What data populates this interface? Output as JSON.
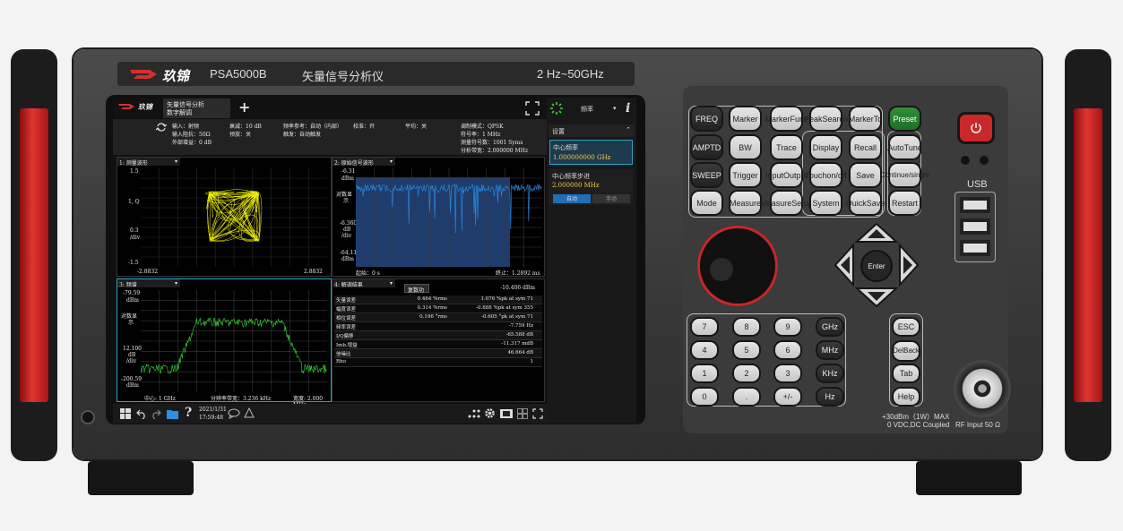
{
  "brand": {
    "logo_text": "玖锦",
    "model": "PSA5000B",
    "product_name": "矢量信号分析仪",
    "freq_range": "2 Hz~50GHz"
  },
  "screen": {
    "header": {
      "app_title": "矢量信号分析",
      "app_subtitle": "数字解调",
      "add_label": "+",
      "input_line": "输入：射频",
      "input_imp": "输入阻抗：50Ω",
      "ext_gain": "外部增益：0 dB",
      "atten": "衰减：10 dB",
      "preamp": "预放：关",
      "freq_ref": "频率参考：自动（内部）",
      "trigger": "触发：自动触发",
      "calib": "校准：开",
      "avg": "平均：关",
      "mod_fmt": "调制模式：QPSK",
      "sym_rate": "符号率：1 MHz",
      "meas_syms": "测量符号数：1001 Syms",
      "ana_bw": "分析带宽：2.000000 MHz"
    },
    "win1": {
      "title": "1: 测量波形",
      "y_top": "1.5",
      "y_mid": "1, Q",
      "y_div1": "0.3",
      "y_div2": "/div",
      "y_bot": "-1.5",
      "x_left": "-2.8832",
      "x_right": "2.8832"
    },
    "win2": {
      "title": "2: 原始信号波形",
      "y_top": "-6.31",
      "y_unit": "dBm",
      "y_lbl1": "对数显",
      "y_lbl2": "示",
      "y_m1": "-6.360",
      "y_m2": "dB",
      "y_m3": "/div",
      "y_bot": "-64.11",
      "y_bot_unit": "dBm",
      "x_start": "起始：0 s",
      "x_stop": "终止：1.2892 ms"
    },
    "win3": {
      "title": "3: 频谱",
      "y_top": "-79.59",
      "y_unit": "dBm",
      "y_lbl1": "对数显",
      "y_lbl2": "示",
      "y_m1": "12.100",
      "y_m2": "dB",
      "y_m3": "/div",
      "y_bot": "-200.59",
      "y_bot_unit": "dBm",
      "center": "中心: 1 GHz",
      "rbw": "分辨率带宽：3.236 kHz",
      "span": "宽度: 2.000 MHz"
    },
    "win4": {
      "title": "4: 解调结果",
      "tab": "复数功率",
      "power": "-10.406 dBm",
      "rows": [
        {
          "name": "矢量误差",
          "v1": "0.464 %rms",
          "v2": "1.076 %pk at sym 71"
        },
        {
          "name": "幅度误差",
          "v1": "0.314 %rms",
          "v2": "-0.888 %pk at sym 355"
        },
        {
          "name": "相位误差",
          "v1": "0.196 °rms",
          "v2": "-0.605 °pk at sym 71"
        },
        {
          "name": "频率误差",
          "v1": "",
          "v2": "-7.759 Hz"
        },
        {
          "name": "I/Q偏移",
          "v1": "",
          "v2": "-65.588 dB"
        },
        {
          "name": "Imb.增益",
          "v1": "",
          "v2": "-11.317 mdB"
        },
        {
          "name": "信噪比",
          "v1": "",
          "v2": "46.664 dB"
        },
        {
          "name": "Rho",
          "v1": "",
          "v2": "1"
        }
      ]
    },
    "taskbar": {
      "date": "2021/1/31",
      "time": "17:59:48"
    }
  },
  "panel": {
    "dropdown": "频率",
    "info": "i",
    "section": "设置",
    "center_label": "中心频率",
    "center_value": "1.000000000 GHz",
    "step_label": "中心频率步进",
    "step_value": "2.000000 MHz",
    "auto": "自动",
    "manual": "手动"
  },
  "keys": {
    "freq": "FREQ",
    "marker": "Marker",
    "marker_func": [
      "Marker",
      "Func"
    ],
    "peak_search": [
      "Peak",
      "Search"
    ],
    "marker_to": [
      "Marker",
      "To"
    ],
    "preset": "Preset",
    "amptd": "AMPTD",
    "bw": "BW",
    "trace": "Trace",
    "display": "Display",
    "recall": "Recall",
    "auto_tune": [
      "Auto",
      "Tune"
    ],
    "sweep": "SWEEP",
    "trigger": "Trigger",
    "input_output": [
      "Input",
      "Output"
    ],
    "touch": [
      "Touch",
      "on/off"
    ],
    "save": "Save",
    "continue": [
      "Continue",
      "/single"
    ],
    "mode": "Mode",
    "measure": "Measure",
    "measure_setup": [
      "Measure",
      "Setup"
    ],
    "system": "System",
    "quick_save": [
      "Quick",
      "Save"
    ],
    "restart": "Restart",
    "enter": "Enter",
    "k7": "7",
    "k8": "8",
    "k9": "9",
    "ghz": "GHz",
    "k4": "4",
    "k5": "5",
    "k6": "6",
    "mhz": "MHz",
    "k1": "1",
    "k2": "2",
    "k3": "3",
    "khz": "KHz",
    "k0": "0",
    "dot": ".",
    "pm": "+/-",
    "hz": "Hz",
    "esc": "ESC",
    "del": [
      "Del",
      "Back"
    ],
    "tab": "Tab",
    "help": "Help"
  },
  "usb_label": "USB",
  "rf_spec1": "+30dBm（1W）MAX",
  "rf_spec2": "0 VDC,DC Coupled",
  "rf_input": "RF Input 50 Ω",
  "colors": {
    "chassis": "#3c3c3c",
    "handle": "#d42a2a",
    "power": "#c8282a",
    "trace": "#2a8fe6",
    "spectrum": "#3ad43a",
    "constellation": "#ffff00"
  }
}
